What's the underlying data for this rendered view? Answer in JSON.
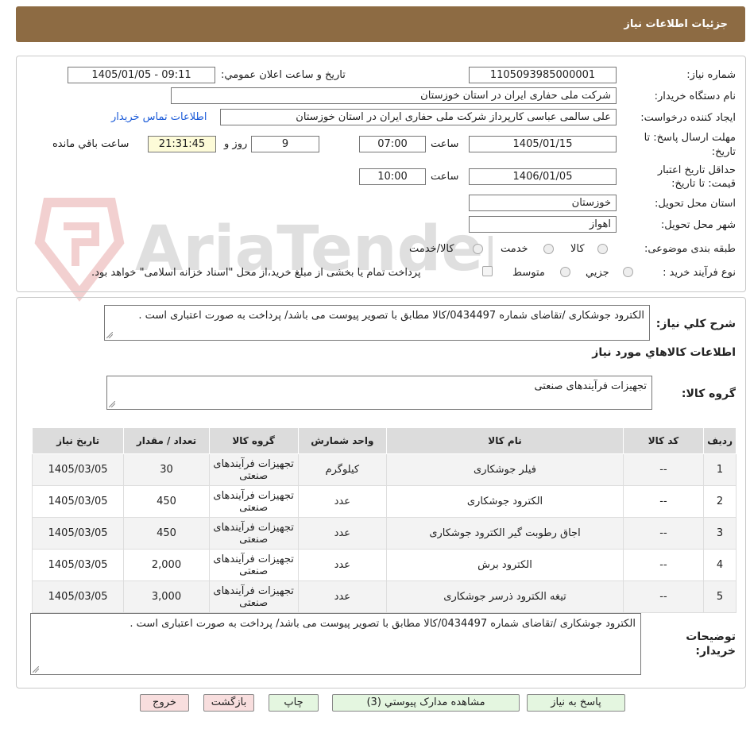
{
  "header": {
    "title": "جزئیات اطلاعات نیاز"
  },
  "watermark": {
    "text": "AriaTender.net"
  },
  "info": {
    "need_number_label": "شماره نیاز:",
    "need_number": "1105093985000001",
    "announce_label": "تاریخ و ساعت اعلان عمومي:",
    "announce_value": "1405/01/05 - 09:11",
    "buyer_label": "نام دستگاه خریدار:",
    "buyer_value": "شرکت ملی حفاری ایران در استان خوزستان",
    "creator_label": "ایجاد کننده درخواست:",
    "creator_value": "علی سالمی عباسی کارپرداز شرکت ملی حفاری ایران در استان خوزستان",
    "contact_link": "اطلاعات تماس خریدار",
    "deadline_label_1": "مهلت ارسال پاسخ: تا",
    "deadline_label_2": "تاریخ:",
    "deadline_date": "1405/01/15",
    "time_label": "ساعت",
    "deadline_time": "07:00",
    "days_value": "9",
    "days_label": "روز و",
    "remaining_time": "21:31:45",
    "remaining_label": "ساعت باقي مانده",
    "validity_label_1": "حداقل تاریخ اعتبار",
    "validity_label_2": "قیمت: تا تاریخ:",
    "validity_date": "1406/01/05",
    "validity_time_label": "ساعت",
    "validity_time": "10:00",
    "province_label": "استان محل تحویل:",
    "province_value": "خوزستان",
    "city_label": "شهر محل تحویل:",
    "city_value": "اهواز",
    "category_label": "طبقه بندی موضوعی:",
    "category_options": [
      "کالا",
      "خدمت",
      "کالا/خدمت"
    ],
    "process_label": "نوع فرآیند خرید :",
    "process_options": [
      "جزیي",
      "متوسط"
    ],
    "process_note": "پرداخت تمام یا بخشی از مبلغ خرید،از محل \"اسناد خزانه اسلامی\" خواهد بود."
  },
  "summary": {
    "label": "شرح کلي نیاز:",
    "text": "الکترود جوشکاری /تقاضای شماره 0434497/کالا مطابق با تصویر پیوست می باشد/ پرداخت به صورت اعتباری است ."
  },
  "goods": {
    "section_title": "اطلاعات کالاهاي مورد نیاز",
    "group_label": "گروه کالا:",
    "group_value": "تجهیزات فرآیندهای صنعتی",
    "columns": [
      "ردیف",
      "کد کالا",
      "نام کالا",
      "واحد شمارش",
      "گروه کالا",
      "تعداد / مقدار",
      "تاریخ نیاز"
    ],
    "rows": [
      [
        "1",
        "--",
        "فیلر جوشکاری",
        "کیلوگرم",
        "تجهیزات فرآیندهای صنعتی",
        "30",
        "1405/03/05"
      ],
      [
        "2",
        "--",
        "الکترود جوشکاری",
        "عدد",
        "تجهیزات فرآیندهای صنعتی",
        "450",
        "1405/03/05"
      ],
      [
        "3",
        "--",
        "اجاق رطوبت گیر الکترود جوشکاری",
        "عدد",
        "تجهیزات فرآیندهای صنعتی",
        "450",
        "1405/03/05"
      ],
      [
        "4",
        "--",
        "الکترود برش",
        "عدد",
        "تجهیزات فرآیندهای صنعتی",
        "2,000",
        "1405/03/05"
      ],
      [
        "5",
        "--",
        "تیغه الکترود ذرسر جوشکاری",
        "عدد",
        "تجهیزات فرآیندهای صنعتی",
        "3,000",
        "1405/03/05"
      ]
    ]
  },
  "buyer_notes": {
    "label_1": "توضیحات",
    "label_2": "خریدار:",
    "text": "الکترود جوشکاری /تقاضای شماره 0434497/کالا مطابق با تصویر پیوست می باشد/ پرداخت به صورت اعتباری است ."
  },
  "buttons": {
    "reply": "پاسخ به نیاز",
    "attachments": "مشاهده مدارک پیوستي (3)",
    "print": "چاپ",
    "back": "بازگشت",
    "exit": "خروج"
  },
  "colors": {
    "header_bg": "#8d6b43",
    "link": "#1a5ad8",
    "button_green": "#e4f6e0",
    "button_pink": "#f8dede",
    "highlight_yellow": "#fdfbd8"
  }
}
